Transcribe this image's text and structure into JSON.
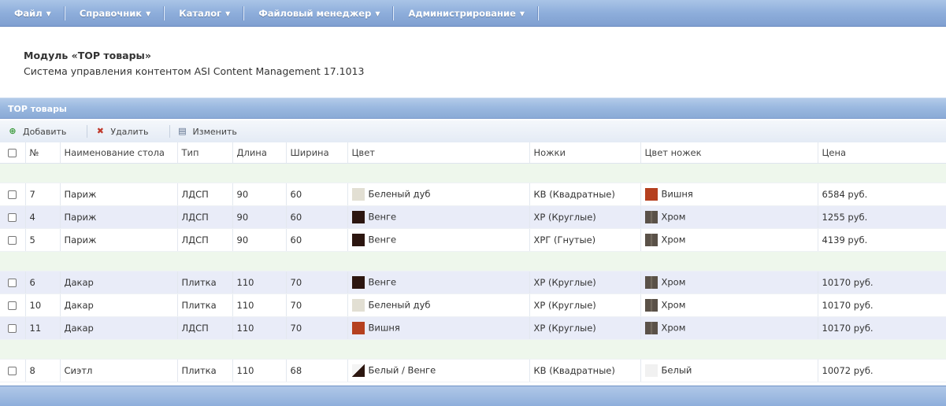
{
  "menu": [
    {
      "label": "Файл"
    },
    {
      "label": "Справочник"
    },
    {
      "label": "Каталог"
    },
    {
      "label": "Файловый менеджер"
    },
    {
      "label": "Администрирование"
    }
  ],
  "module": {
    "title": "Модуль «TOP товары»",
    "subtitle": "Система управления контентом ASI Content Management 17.1013"
  },
  "section_title": "TOP товары",
  "toolbar": {
    "add": "Добавить",
    "delete": "Удалить",
    "edit": "Изменить"
  },
  "columns": [
    "№",
    "Наименование стола",
    "Тип",
    "Длина",
    "Ширина",
    "Цвет",
    "Ножки",
    "Цвет ножек",
    "Цена"
  ],
  "rows": [
    {
      "num": "7",
      "name": "Париж",
      "type": "ЛДСП",
      "length": "90",
      "width": "60",
      "color": "Беленый дуб",
      "color_swatch": "bel",
      "legs": "КВ (Квадратные)",
      "legs_color": "Вишня",
      "legs_swatch": "vishnya",
      "price": "6584 руб."
    },
    {
      "num": "4",
      "name": "Париж",
      "type": "ЛДСП",
      "length": "90",
      "width": "60",
      "color": "Венге",
      "color_swatch": "wenge",
      "legs": "ХР (Круглые)",
      "legs_color": "Хром",
      "legs_swatch": "chrome",
      "price": "1255 руб."
    },
    {
      "num": "5",
      "name": "Париж",
      "type": "ЛДСП",
      "length": "90",
      "width": "60",
      "color": "Венге",
      "color_swatch": "wenge",
      "legs": "ХРГ (Гнутые)",
      "legs_color": "Хром",
      "legs_swatch": "chrome",
      "price": "4139 руб."
    },
    {
      "num": "6",
      "name": "Дакар",
      "type": "Плитка",
      "length": "110",
      "width": "70",
      "color": "Венге",
      "color_swatch": "wenge",
      "legs": "ХР (Круглые)",
      "legs_color": "Хром",
      "legs_swatch": "chrome",
      "price": "10170 руб."
    },
    {
      "num": "10",
      "name": "Дакар",
      "type": "Плитка",
      "length": "110",
      "width": "70",
      "color": "Беленый дуб",
      "color_swatch": "bel",
      "legs": "ХР (Круглые)",
      "legs_color": "Хром",
      "legs_swatch": "chrome",
      "price": "10170 руб."
    },
    {
      "num": "11",
      "name": "Дакар",
      "type": "ЛДСП",
      "length": "110",
      "width": "70",
      "color": "Вишня",
      "color_swatch": "vishnya",
      "legs": "ХР (Круглые)",
      "legs_color": "Хром",
      "legs_swatch": "chrome",
      "price": "10170 руб."
    },
    {
      "num": "8",
      "name": "Сиэтл",
      "type": "Плитка",
      "length": "110",
      "width": "68",
      "color": "Белый / Венге",
      "color_swatch": "whitewenge",
      "legs": "КВ (Квадратные)",
      "legs_color": "Белый",
      "legs_swatch": "white",
      "price": "10072 руб."
    }
  ],
  "colors": {
    "menu_bar": "#8eaedb",
    "group_row": "#eef7ec",
    "alt_row": "#e9ecf8"
  }
}
